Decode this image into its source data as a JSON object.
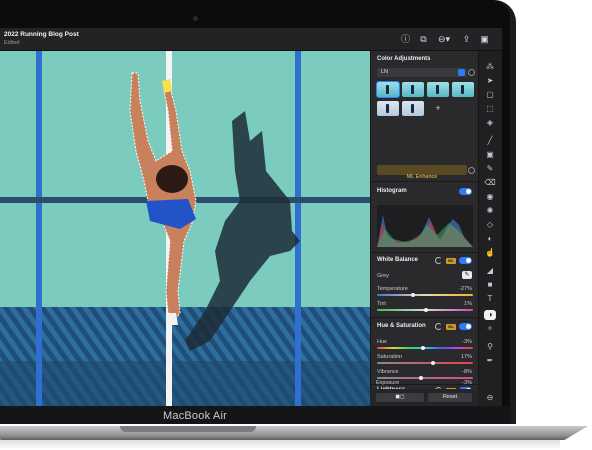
{
  "device": {
    "brand_label": "MacBook Air"
  },
  "document": {
    "title": "2022 Running Blog Post",
    "subtitle": "Edited"
  },
  "toolbar": {
    "icons": [
      "info-icon",
      "crop-icon",
      "more-icon",
      "share-icon",
      "sidebar-icon"
    ]
  },
  "panel": {
    "header": "Color Adjustments",
    "preset_select": "LN",
    "ml_enhance_label": "ML Enhance",
    "histogram": {
      "label": "Histogram",
      "enabled": true
    },
    "white_balance": {
      "label": "White Balance",
      "ml_badge": "ML",
      "enabled": true,
      "grey_label": "Grey",
      "sliders": [
        {
          "label": "Temperature",
          "value": "-27%",
          "level": 0.37
        },
        {
          "label": "Tint",
          "value": "1%",
          "level": 0.51
        }
      ]
    },
    "hue_saturation": {
      "label": "Hue & Saturation",
      "ml_badge": "ML",
      "enabled": true,
      "sliders": [
        {
          "label": "Hue",
          "value": "-3%",
          "level": 0.48
        },
        {
          "label": "Saturation",
          "value": "17%",
          "level": 0.58
        },
        {
          "label": "Vibrance",
          "value": "-8%",
          "level": 0.46
        }
      ]
    },
    "lightness": {
      "label": "Lightness",
      "ml_badge": "ML",
      "enabled": true,
      "exposure_label": "Exposure",
      "exposure_value": "-3%"
    },
    "bottom": {
      "compare_label": "◼◻",
      "reset_label": "Reset"
    }
  },
  "tools_sidebar": [
    "brush-icon",
    "arrow-icon",
    "select-rect-icon",
    "magic-select-icon",
    "adjust-icon",
    "pen-icon",
    "bucket-icon",
    "pencil-icon",
    "eraser-icon",
    "clone-icon",
    "retouch-icon",
    "sharpen-icon",
    "burn-icon",
    "smudge-icon",
    "gradient-icon",
    "shape-icon",
    "text-icon",
    "color-adjust-icon",
    "effects-icon",
    "zoom-icon",
    "eyedropper-icon",
    "more-tools-icon"
  ],
  "colors": {
    "accent": "#2f7cf6",
    "ml": "#f2c94c",
    "court": "#7cc9c0",
    "lane": "#2f6fd0"
  }
}
